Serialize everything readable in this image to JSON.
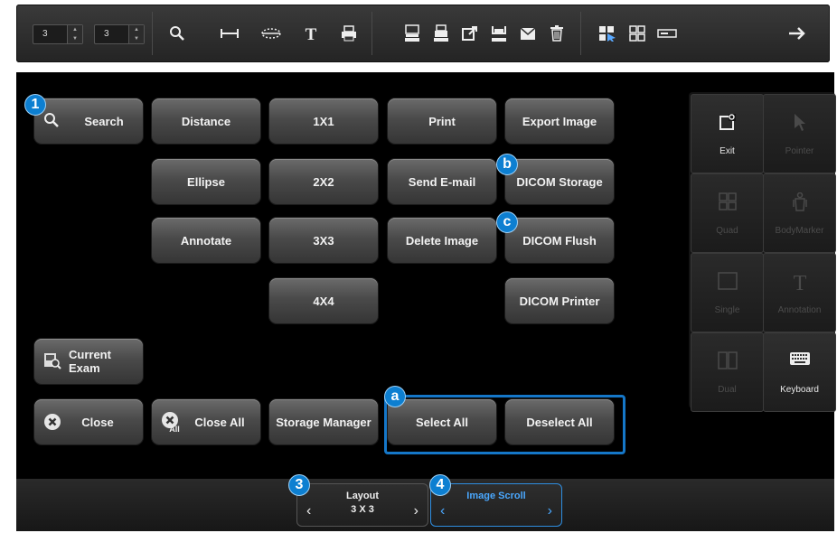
{
  "toolbar": {
    "spin1_value": "3",
    "spin2_value": "3",
    "icons": [
      "search-icon",
      "distance-icon",
      "ellipse-icon",
      "annotate-icon",
      "print-icon",
      "dicom-storage-icon",
      "dicom-printer-icon",
      "export-icon",
      "dicom-flush-icon",
      "email-icon",
      "delete-icon",
      "select-icon",
      "layout-icon",
      "storage-icon",
      "forward-arrow-icon"
    ]
  },
  "buttons": {
    "search": "Search",
    "distance": "Distance",
    "ellipse": "Ellipse",
    "annotate": "Annotate",
    "layout_1x1": "1X1",
    "layout_2x2": "2X2",
    "layout_3x3": "3X3",
    "layout_4x4": "4X4",
    "print": "Print",
    "send_email": "Send E-mail",
    "delete_image": "Delete Image",
    "export_image": "Export Image",
    "dicom_storage": "DICOM Storage",
    "dicom_flush": "DICOM Flush",
    "dicom_printer": "DICOM Printer",
    "current_exam": "Current Exam",
    "close": "Close",
    "close_all": "Close All",
    "storage_manager": "Storage Manager",
    "select_all": "Select All",
    "deselect_all": "Deselect All"
  },
  "markers": {
    "m1": "1",
    "m3": "3",
    "m4": "4",
    "ma": "a",
    "mb": "b",
    "mc": "c"
  },
  "side_panel": {
    "exit": "Exit",
    "pointer": "Pointer",
    "quad": "Quad",
    "bodymarker": "BodyMarker",
    "single": "Single",
    "annotation": "Annotation",
    "dual": "Dual",
    "keyboard": "Keyboard"
  },
  "bottom": {
    "layout_title": "Layout",
    "layout_value": "3 X 3",
    "scroll_title": "Image Scroll",
    "scroll_value": ""
  },
  "colors": {
    "accent": "#0d7fd1",
    "panel_bg": "#000000",
    "button_top": "#6b6b6b",
    "button_bottom": "#353535"
  }
}
